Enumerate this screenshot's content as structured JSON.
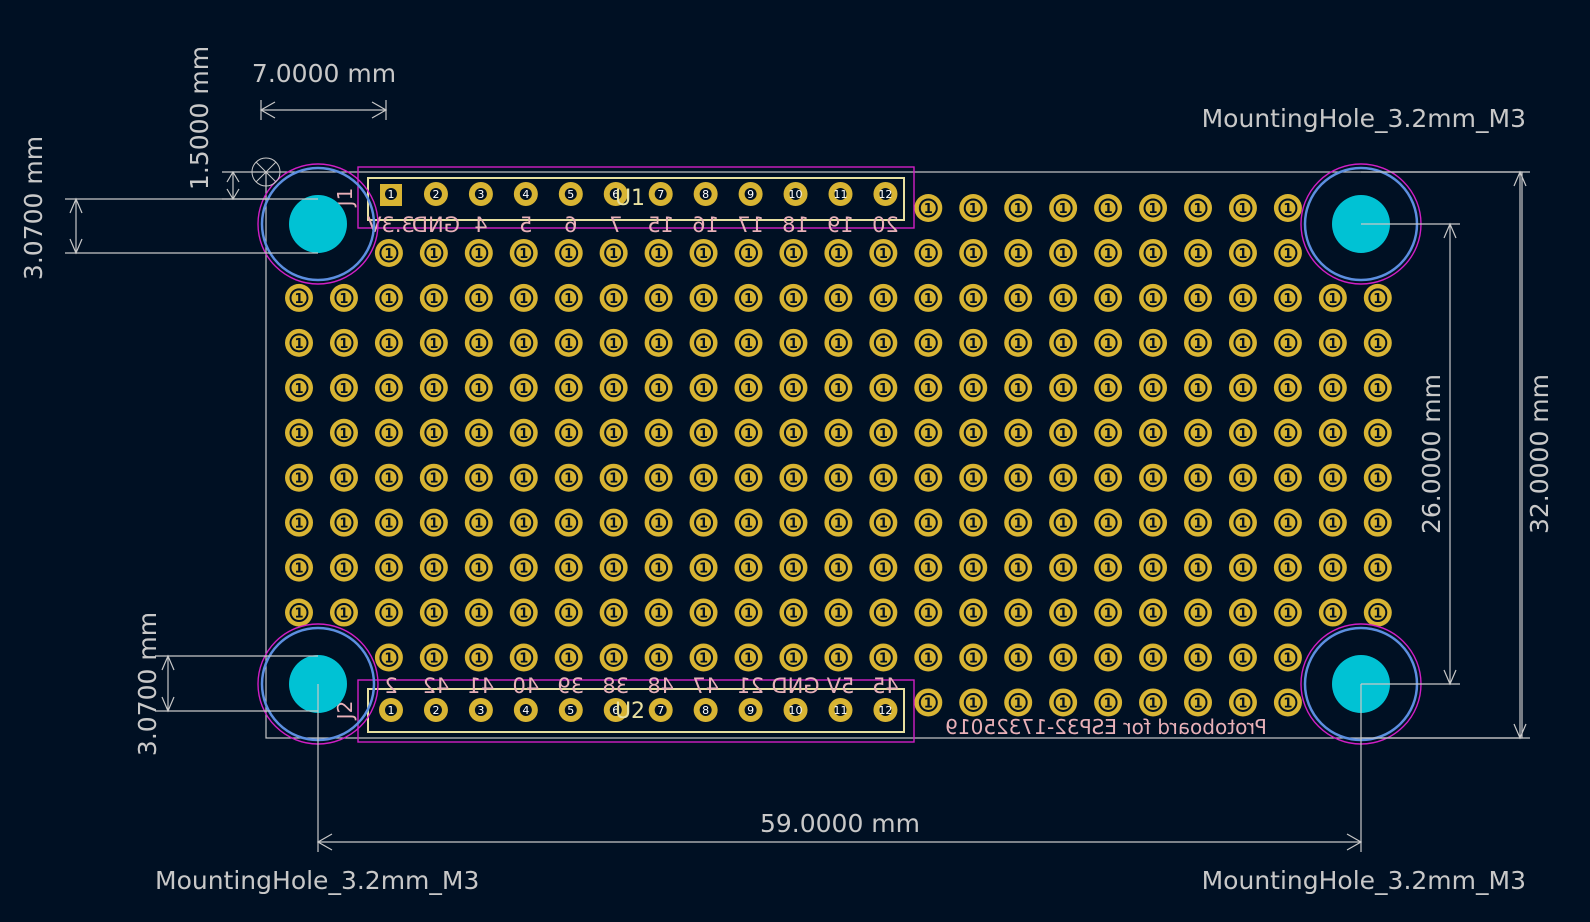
{
  "colors": {
    "background": "#001023",
    "pad": "#d8b433",
    "pad_center": "#001023",
    "drill": "#00c2d4",
    "dimension": "#c8c8c8",
    "courtyard": "#d01ec4",
    "hole_ring": "#5c8fe0",
    "fab": "#e8e0a0",
    "silk_back": "#e8b0b8",
    "dim_text": "#c8c8c8",
    "edge": "#c8c8c8"
  },
  "dimensions": {
    "pin_offset": "7.0000 mm",
    "top_margin": "1.5000 mm",
    "hole_offset_top": "3.0700 mm",
    "hole_offset_bottom": "3.0700 mm",
    "width": "59.0000 mm",
    "hole_spacing_v": "26.0000 mm",
    "height": "32.0000 mm"
  },
  "mounting_holes": {
    "top_right": "MountingHole_3.2mm_M3",
    "bottom_left": "MountingHole_3.2mm_M3",
    "bottom_right": "MountingHole_3.2mm_M3"
  },
  "headers": {
    "u1": {
      "ref": "U1",
      "conn": "J1",
      "pin_numbers": [
        "1",
        "2",
        "3",
        "4",
        "5",
        "6",
        "7",
        "8",
        "9",
        "10",
        "11",
        "12"
      ],
      "pin_names": [
        "3.3V",
        "GND",
        "4",
        "5",
        "6",
        "7",
        "15",
        "16",
        "17",
        "18",
        "19",
        "20"
      ]
    },
    "u2": {
      "ref": "U2",
      "conn": "J2",
      "pin_numbers": [
        "1",
        "2",
        "3",
        "4",
        "5",
        "6",
        "7",
        "8",
        "9",
        "10",
        "11",
        "12"
      ],
      "pin_names": [
        "2",
        "42",
        "41",
        "40",
        "39",
        "38",
        "48",
        "47",
        "21",
        "GND",
        "5V",
        "45"
      ]
    }
  },
  "pad_label": "1",
  "board_label": "Protoboard for ESP32-17325019"
}
